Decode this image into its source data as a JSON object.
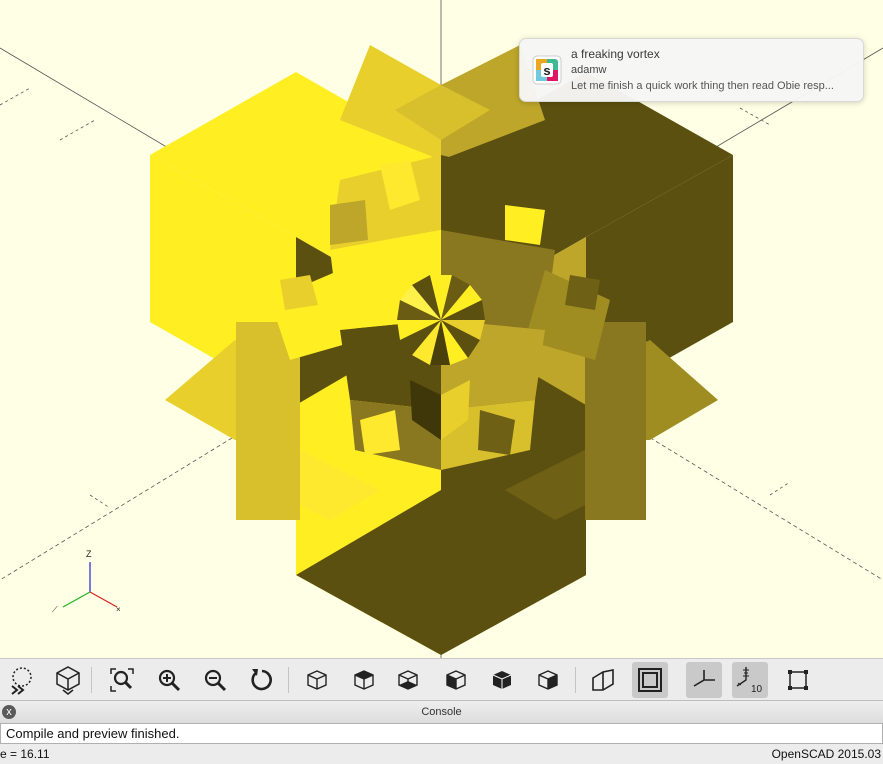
{
  "notification": {
    "title": "a freaking vortex",
    "sender": "adamw",
    "message": "Let me finish a quick work thing then read Obie resp...",
    "app_icon": "slack-icon"
  },
  "axes_indicator": {
    "z_label": "Z",
    "colors": {
      "x": "#d42020",
      "y": "#20b020",
      "z": "#2020d4"
    }
  },
  "model": {
    "colors": {
      "light": "#ffee22",
      "mid": "#e8cf2c",
      "dark": "#5c5010",
      "medium": "#bda62a"
    }
  },
  "toolbar": {
    "buttons": [
      {
        "name": "render-button",
        "icon": "render-icon"
      },
      {
        "name": "preview-button",
        "icon": "preview-icon"
      },
      {
        "name": "view-all-button",
        "icon": "zoom-all-icon"
      },
      {
        "name": "zoom-in-button",
        "icon": "zoom-in-icon"
      },
      {
        "name": "zoom-out-button",
        "icon": "zoom-out-icon"
      },
      {
        "name": "reset-view-button",
        "icon": "reset-view-icon"
      },
      {
        "name": "view-right-button",
        "icon": "view-right-icon"
      },
      {
        "name": "view-top-button",
        "icon": "view-top-icon"
      },
      {
        "name": "view-bottom-button",
        "icon": "view-bottom-icon"
      },
      {
        "name": "view-left-button",
        "icon": "view-left-icon"
      },
      {
        "name": "view-front-button",
        "icon": "view-front-icon"
      },
      {
        "name": "view-back-button",
        "icon": "view-back-icon"
      },
      {
        "name": "perspective-button",
        "icon": "perspective-icon"
      },
      {
        "name": "orthogonal-button",
        "icon": "orthogonal-icon"
      },
      {
        "name": "show-axes-button",
        "icon": "axes-icon"
      },
      {
        "name": "show-scale-markers-button",
        "icon": "scale-markers-icon"
      },
      {
        "name": "show-edges-button",
        "icon": "edges-icon"
      }
    ],
    "scale_label": "10"
  },
  "console": {
    "title": "Console",
    "close_label": "x",
    "output": "Compile and preview finished."
  },
  "status": {
    "left": "e = 16.11",
    "right": "OpenSCAD 2015.03"
  }
}
